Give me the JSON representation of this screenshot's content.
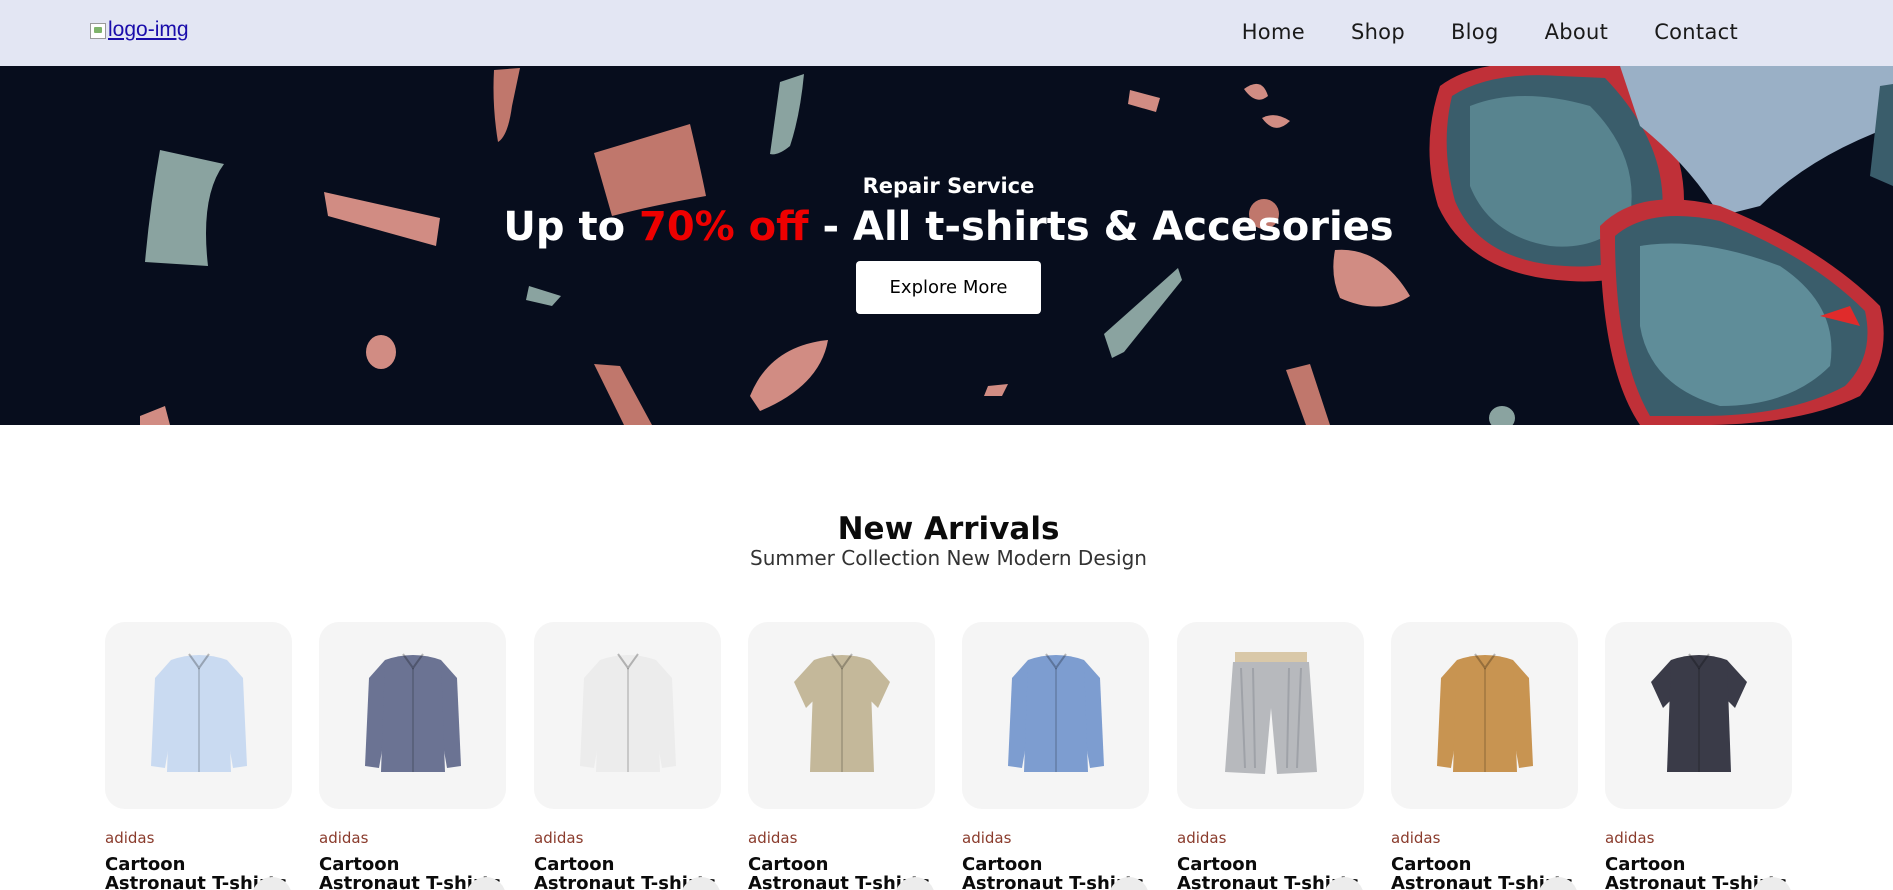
{
  "header": {
    "logo_alt": "logo-img",
    "nav": [
      "Home",
      "Shop",
      "Blog",
      "About",
      "Contact"
    ]
  },
  "hero": {
    "subtitle": "Repair Service",
    "title_prefix": "Up to ",
    "title_accent": "70% off",
    "title_suffix": " - All t-shirts & Accesories",
    "button_label": "Explore More",
    "colors": {
      "background": "#070d1d",
      "accent": "#ee0000"
    }
  },
  "section": {
    "title": "New Arrivals",
    "subtitle": "Summer Collection New Modern Design"
  },
  "products": [
    {
      "brand": "adidas",
      "name": "Cartoon Astronaut T-shirts",
      "icon": "light-blue-shirt-icon",
      "color": "#c9daf1"
    },
    {
      "brand": "adidas",
      "name": "Cartoon Astronaut T-shirts",
      "icon": "patterned-shirt-icon",
      "color": "#6b7393"
    },
    {
      "brand": "adidas",
      "name": "Cartoon Astronaut T-shirts",
      "icon": "white-shirt-icon",
      "color": "#ececec"
    },
    {
      "brand": "adidas",
      "name": "Cartoon Astronaut T-shirts",
      "icon": "floral-shirt-icon",
      "color": "#c4b89a"
    },
    {
      "brand": "adidas",
      "name": "Cartoon Astronaut T-shirts",
      "icon": "denim-shirt-icon",
      "color": "#7d9dd0"
    },
    {
      "brand": "adidas",
      "name": "Cartoon Astronaut T-shirts",
      "icon": "striped-shorts-icon",
      "color": "#b7b9bd"
    },
    {
      "brand": "adidas",
      "name": "Cartoon Astronaut T-shirts",
      "icon": "tan-jacket-icon",
      "color": "#c89451"
    },
    {
      "brand": "adidas",
      "name": "Cartoon Astronaut T-shirts",
      "icon": "dark-shirt-icon",
      "color": "#3a3b48"
    }
  ]
}
